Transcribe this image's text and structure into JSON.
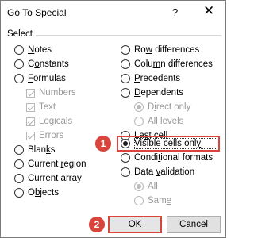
{
  "dialog": {
    "title": "Go To Special",
    "help_glyph": "?",
    "close_glyph": "✕"
  },
  "section_label": "Select",
  "left_options": [
    {
      "pre": "",
      "mn": "N",
      "post": "otes"
    },
    {
      "pre": "C",
      "mn": "o",
      "post": "nstants"
    },
    {
      "pre": "",
      "mn": "F",
      "post": "ormulas"
    }
  ],
  "formula_types": [
    {
      "label": "Numbers",
      "checked": true
    },
    {
      "label": "Text",
      "checked": true
    },
    {
      "label": "Logicals",
      "checked": true
    },
    {
      "label": "Errors",
      "checked": true
    }
  ],
  "left_options_lower": [
    {
      "pre": "Blan",
      "mn": "k",
      "post": "s"
    },
    {
      "pre": "Current ",
      "mn": "r",
      "post": "egion"
    },
    {
      "pre": "Current ",
      "mn": "a",
      "post": "rray"
    },
    {
      "pre": "O",
      "mn": "b",
      "post": "jects"
    }
  ],
  "right_options_top": [
    {
      "pre": "Ro",
      "mn": "w",
      "post": " differences"
    },
    {
      "pre": "Colu",
      "mn": "m",
      "post": "n differences"
    },
    {
      "pre": "",
      "mn": "P",
      "post": "recedents"
    },
    {
      "pre": "",
      "mn": "D",
      "post": "ependents"
    }
  ],
  "dependents_sub": [
    {
      "pre": "D",
      "mn": "i",
      "post": "rect only",
      "checked": true
    },
    {
      "pre": "A",
      "mn": "l",
      "post": "l levels",
      "checked": false
    }
  ],
  "right_options_mid": [
    {
      "pre": "La",
      "mn": "s",
      "post": "t cell"
    },
    {
      "pre": "Visible cells onl",
      "mn": "y",
      "post": "",
      "checked": true
    },
    {
      "pre": "Condi",
      "mn": "t",
      "post": "ional formats"
    },
    {
      "pre": "Data ",
      "mn": "v",
      "post": "alidation"
    }
  ],
  "validation_sub": [
    {
      "pre": "",
      "mn": "A",
      "post": "ll",
      "checked": true
    },
    {
      "pre": "Sam",
      "mn": "e",
      "post": "",
      "checked": false
    }
  ],
  "badges": {
    "one": "1",
    "two": "2"
  },
  "buttons": {
    "ok": "OK",
    "cancel": "Cancel"
  },
  "colors": {
    "annotation": "#d9443d"
  }
}
